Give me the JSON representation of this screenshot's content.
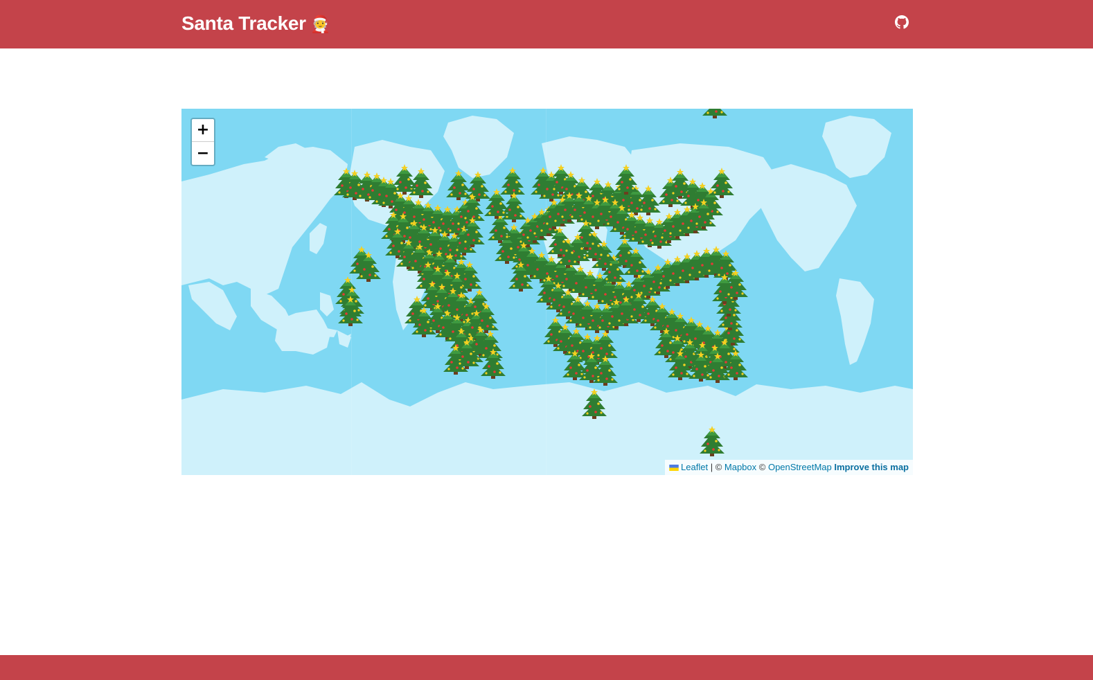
{
  "header": {
    "title": "Santa Tracker",
    "title_emoji": "🧑‍🎄",
    "github_icon": "github-icon",
    "brand_color": "#c4434a"
  },
  "map": {
    "zoom_in_label": "+",
    "zoom_out_label": "−",
    "ocean_color": "#7fd8f3",
    "land_color": "#cff1fb",
    "marker_icon": "christmas-tree-icon",
    "attribution": {
      "flag_icon": "ukraine-flag-icon",
      "leaflet": "Leaflet",
      "sep1": " | © ",
      "mapbox": "Mapbox",
      "sep2": " © ",
      "osm": "OpenStreetMap",
      "sep3": " ",
      "improve": "Improve this map"
    }
  },
  "footer": {
    "color": "#c4434a"
  }
}
